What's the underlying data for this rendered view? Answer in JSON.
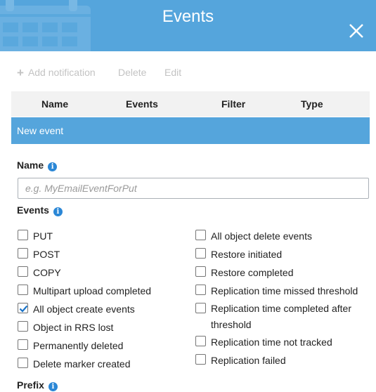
{
  "dialog": {
    "title": "Events",
    "close_icon": "close-icon",
    "header_icon": "calendar-icon",
    "header_color": "#55a5dc"
  },
  "toolbar": {
    "add_label": "Add notification",
    "delete_label": "Delete",
    "edit_label": "Edit"
  },
  "table": {
    "columns": [
      "Name",
      "Events",
      "Filter",
      "Type"
    ],
    "selected_row": "New event",
    "row_color": "#55a5dc"
  },
  "form": {
    "name_label": "Name",
    "name_placeholder": "e.g. MyEmailEventForPut",
    "name_value": "",
    "events_label": "Events",
    "prefix_label": "Prefix",
    "left_events": [
      {
        "label": "PUT",
        "checked": false
      },
      {
        "label": "POST",
        "checked": false
      },
      {
        "label": "COPY",
        "checked": false
      },
      {
        "label": "Multipart upload completed",
        "checked": false
      },
      {
        "label": "All object create events",
        "checked": true
      },
      {
        "label": "Object in RRS lost",
        "checked": false
      },
      {
        "label": "Permanently deleted",
        "checked": false
      },
      {
        "label": "Delete marker created",
        "checked": false
      }
    ],
    "right_events": [
      {
        "label": "All object delete events",
        "checked": false
      },
      {
        "label": "Restore initiated",
        "checked": false
      },
      {
        "label": "Restore completed",
        "checked": false
      },
      {
        "label": "Replication time missed threshold",
        "checked": false
      },
      {
        "label": "Replication time completed after threshold",
        "checked": false
      },
      {
        "label": "Replication time not tracked",
        "checked": false
      },
      {
        "label": "Replication failed",
        "checked": false
      }
    ]
  }
}
